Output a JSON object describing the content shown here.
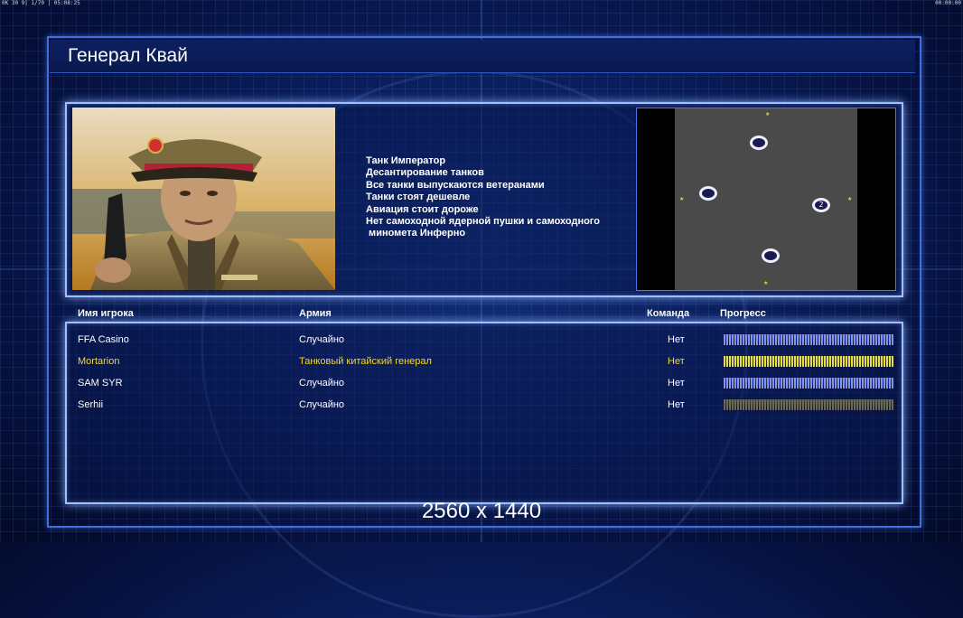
{
  "topbar": {
    "left": "0K 30 9| 1/70 | 05:08:25",
    "right": "00:00:00"
  },
  "title": "Генерал Квай",
  "general": {
    "traits": [
      "Танк Император",
      "Десантирование танков",
      "Все танки выпускаются ветеранами",
      "Танки стоят дешевле",
      "Авиация стоит дороже",
      "Нет самоходной ядерной пушки и самоходного",
      " минометa Инферно"
    ]
  },
  "map": {
    "spawn_labels": [
      "",
      "",
      "2",
      ""
    ]
  },
  "table": {
    "headers": {
      "player": "Имя игрока",
      "army": "Армия",
      "team": "Команда",
      "progress": "Прогресс"
    },
    "rows": [
      {
        "name": "FFA Casino",
        "army": "Случайно",
        "team": "Нет",
        "color": "#ffffff",
        "bar_color": "#7f93ff",
        "progress": 1.0
      },
      {
        "name": "Mortarion",
        "army": "Танковый китайский генерал",
        "team": "Нет",
        "color": "#f2d630",
        "bar_color": "#e6e040",
        "progress": 1.0
      },
      {
        "name": "SAM SYR",
        "army": "Случайно",
        "team": "Нет",
        "color": "#ffffff",
        "bar_color": "#7f93ff",
        "progress": 1.0
      },
      {
        "name": "Serhii",
        "army": "Случайно",
        "team": "Нет",
        "color": "#ffffff",
        "bar_color": "#6a6a55",
        "progress": 1.0
      }
    ]
  },
  "watermark": "2560 x 1440"
}
